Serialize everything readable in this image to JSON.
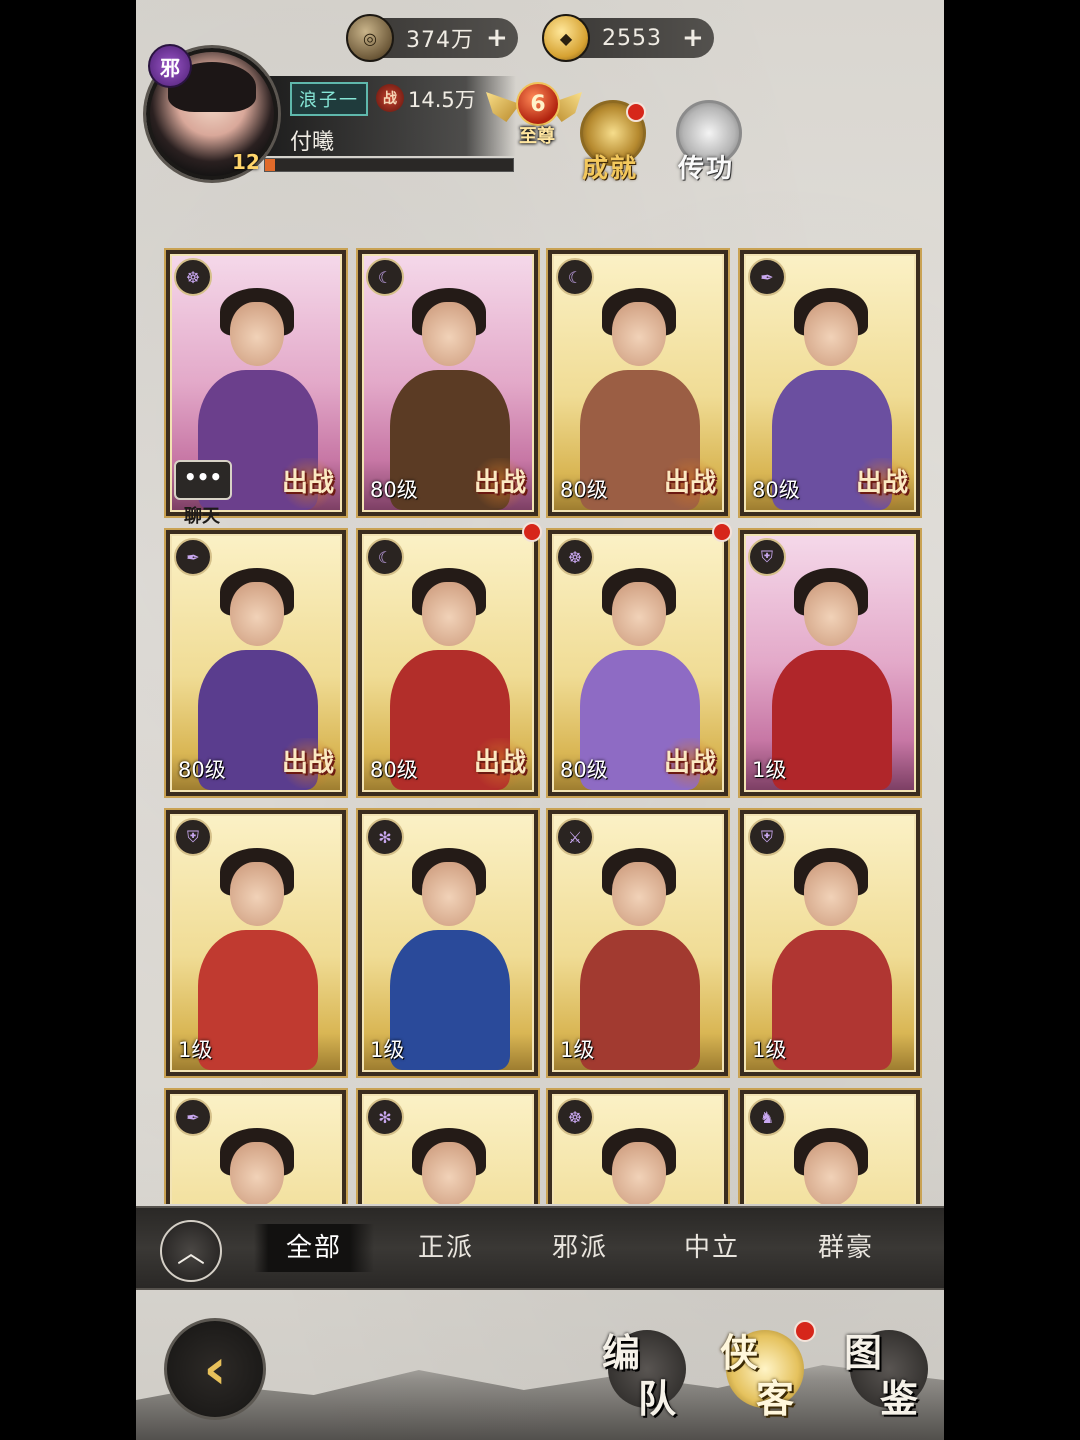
{
  "currency": {
    "copper": {
      "icon": "copper-coin-icon",
      "value": "374万",
      "plus": "+"
    },
    "gold": {
      "icon": "gold-ingot-icon",
      "value": "2553",
      "plus": "+"
    }
  },
  "profile": {
    "faction_badge": "邪",
    "level": "12",
    "title_tag": "浪子一",
    "power_icon_char": "战",
    "power": "14.5万",
    "name": "付曦",
    "exp_fraction": 0.04
  },
  "vip": {
    "level": "6",
    "label": "至尊"
  },
  "buttons": {
    "achievement": "成就",
    "inherit": "传功"
  },
  "chat": {
    "bubble": "•••",
    "label": "聊天"
  },
  "cards": [
    {
      "level": "",
      "deploy": "出战",
      "frame": "pink",
      "body_color": "#6b3f8c",
      "faction_icon": "mask-icon"
    },
    {
      "level": "80级",
      "deploy": "出战",
      "frame": "pink",
      "body_color": "#5b3b24",
      "faction_icon": "crescent-icon"
    },
    {
      "level": "80级",
      "deploy": "出战",
      "frame": "gold",
      "body_color": "#9b5e44",
      "faction_icon": "crescent-icon"
    },
    {
      "level": "80级",
      "deploy": "出战",
      "frame": "gold",
      "body_color": "#6b4fa0",
      "faction_icon": "feather-icon"
    },
    {
      "level": "80级",
      "deploy": "出战",
      "frame": "gold",
      "body_color": "#5a3d8e",
      "faction_icon": "feather-icon"
    },
    {
      "level": "80级",
      "deploy": "出战",
      "frame": "gold",
      "body_color": "#b22e2a",
      "faction_icon": "crescent-icon"
    },
    {
      "level": "80级",
      "deploy": "出战",
      "frame": "gold",
      "body_color": "#8e6bc4",
      "faction_icon": "mask-icon"
    },
    {
      "level": "1级",
      "deploy": "",
      "frame": "pink",
      "body_color": "#b0262a",
      "faction_icon": "shield-icon"
    },
    {
      "level": "1级",
      "deploy": "",
      "frame": "gold",
      "body_color": "#c03a30",
      "faction_icon": "shield-icon"
    },
    {
      "level": "1级",
      "deploy": "",
      "frame": "gold",
      "body_color": "#2a4a9a",
      "faction_icon": "snowflake-icon"
    },
    {
      "level": "1级",
      "deploy": "",
      "frame": "gold",
      "body_color": "#a23a30",
      "faction_icon": "sword-icon"
    },
    {
      "level": "1级",
      "deploy": "",
      "frame": "gold",
      "body_color": "#b03632",
      "faction_icon": "shield-icon"
    },
    {
      "level": "",
      "deploy": "",
      "frame": "gold",
      "body_color": "#7a5fb0",
      "faction_icon": "feather-icon"
    },
    {
      "level": "",
      "deploy": "",
      "frame": "gold",
      "body_color": "#7f5a40",
      "faction_icon": "snowflake-icon"
    },
    {
      "level": "",
      "deploy": "",
      "frame": "gold",
      "body_color": "#3a2a22",
      "faction_icon": "mask-icon"
    },
    {
      "level": "",
      "deploy": "",
      "frame": "gold",
      "body_color": "#d8d0c4",
      "faction_icon": "horse-icon"
    }
  ],
  "tabs": [
    "全部",
    "正派",
    "邪派",
    "中立",
    "群豪"
  ],
  "active_tab": "全部",
  "nav": {
    "team": [
      "编",
      "队"
    ],
    "heroes": [
      "侠",
      "客"
    ],
    "atlas": [
      "图",
      "鉴"
    ]
  },
  "colors": {
    "accent_gold": "#e8c15a",
    "notify_red": "#d6261a"
  }
}
